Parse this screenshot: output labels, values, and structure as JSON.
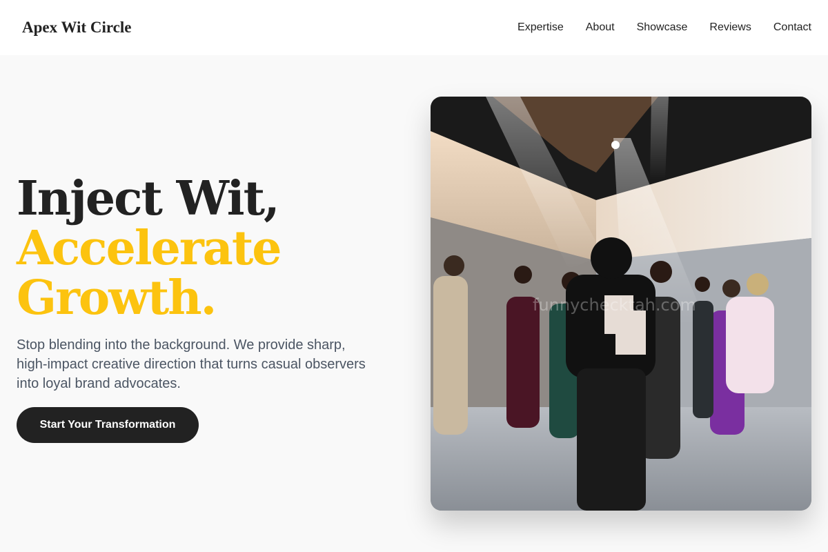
{
  "header": {
    "brand": "Apex Wit Circle",
    "nav": [
      {
        "label": "Expertise"
      },
      {
        "label": "About"
      },
      {
        "label": "Showcase"
      },
      {
        "label": "Reviews"
      },
      {
        "label": "Contact"
      }
    ]
  },
  "hero": {
    "headline_line1": "Inject Wit,",
    "headline_line2": "Accelerate",
    "headline_line3": "Growth.",
    "subtitle": "Stop blending into the background. We provide sharp, high-impact creative direction that turns casual observers into loyal brand advocates.",
    "cta_label": "Start Your Transformation",
    "image_watermark": "funnychecktah.com"
  },
  "colors": {
    "accent": "#fcc30f",
    "text_dark": "#222222",
    "text_muted": "#4b5563",
    "background": "#f9f9f9",
    "header_bg": "#ffffff"
  }
}
